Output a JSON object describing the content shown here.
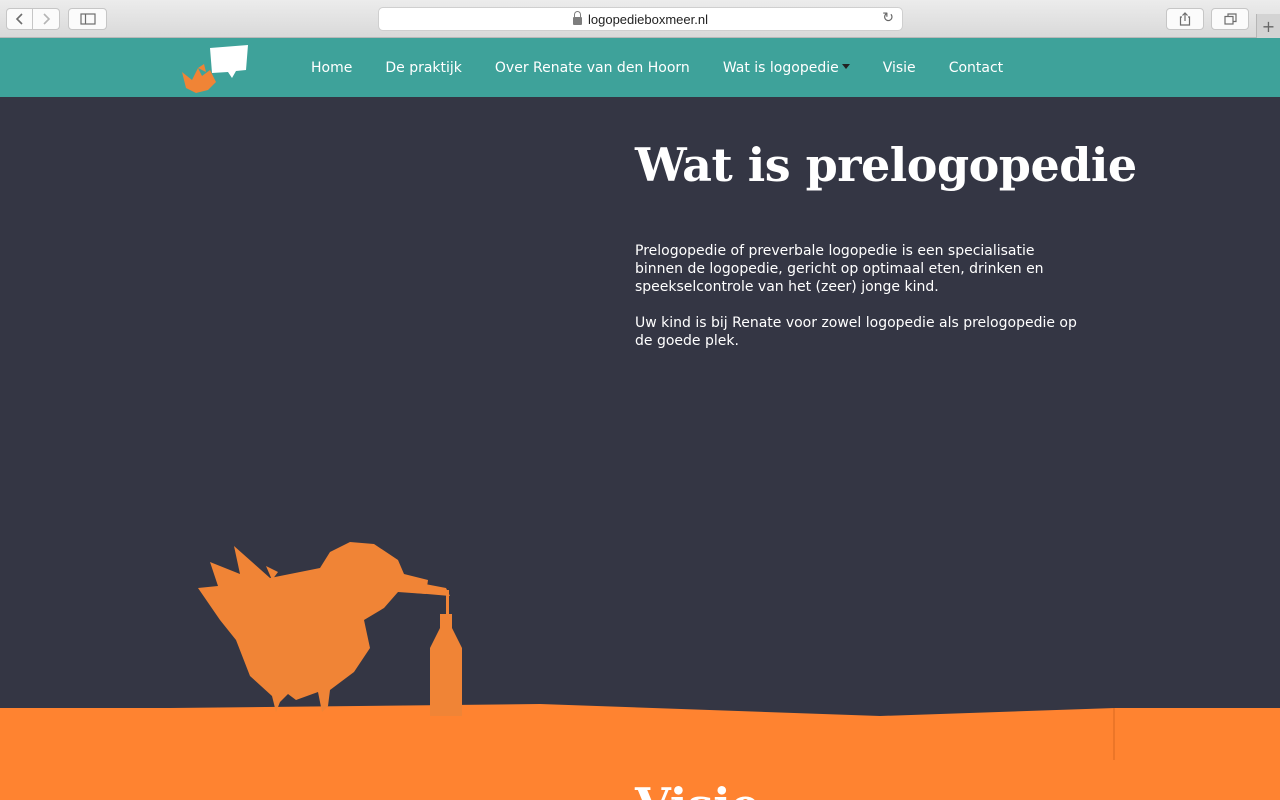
{
  "browser": {
    "url": "logopedieboxmeer.nl",
    "back_icon": "chevron-left-icon",
    "forward_icon": "chevron-right-icon",
    "sidebar_icon": "sidebar-icon",
    "share_icon": "share-icon",
    "tabs_icon": "tabs-icon",
    "reload_icon": "reload-icon",
    "newtab_icon": "plus-icon"
  },
  "nav": {
    "items": [
      {
        "label": "Home"
      },
      {
        "label": "De praktijk"
      },
      {
        "label": "Over Renate van den Hoorn"
      },
      {
        "label": "Wat is logopedie"
      },
      {
        "label": "Visie"
      },
      {
        "label": "Contact"
      }
    ]
  },
  "hero": {
    "title": "Wat is prelogopedie",
    "paragraphs": [
      "Prelogopedie of preverbale logopedie is een specialisatie binnen de logopedie, gericht op optimaal eten, drinken en speekselcontrole van het (zeer) jonge kind.",
      "Uw kind is bij Renate voor zowel logopedie als prelogopedie op de goede plek."
    ]
  },
  "next_section": {
    "title": "Visie"
  },
  "colors": {
    "header": "#3ea29a",
    "background": "#343644",
    "accent_orange": "#ff8330",
    "bird_orange": "#f08436"
  }
}
